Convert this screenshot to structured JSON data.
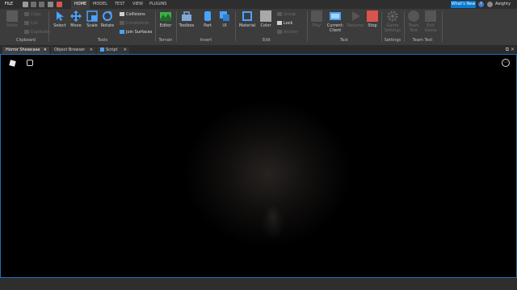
{
  "titlebar": {
    "file_label": "FILE",
    "tabs": [
      "HOME",
      "MODEL",
      "TEST",
      "VIEW",
      "PLUGINS"
    ],
    "active_tab": "HOME",
    "whats_new_label": "What's New",
    "username": "Aeighty"
  },
  "ribbon": {
    "clipboard": {
      "paste": "Paste",
      "copy": "Copy",
      "cut": "Cut",
      "duplicate": "Duplicate",
      "label": "Clipboard"
    },
    "tools": {
      "select": "Select",
      "move": "Move",
      "scale": "Scale",
      "rotate": "Rotate",
      "collisions": "Collisions",
      "constraints": "Constraints",
      "join_surfaces": "Join Surfaces",
      "label": "Tools"
    },
    "terrain": {
      "editor": "Editor",
      "label": "Terrain"
    },
    "insert": {
      "toolbox": "Toolbox",
      "part": "Part",
      "ui": "UI",
      "label": "Insert"
    },
    "edit": {
      "material": "Material",
      "color": "Color",
      "group": "Group",
      "lock": "Lock",
      "anchor": "Anchor",
      "label": "Edit"
    },
    "test": {
      "play": "Play",
      "current_client": "Current:",
      "client": "Client",
      "resume": "Resume",
      "stop": "Stop",
      "label": "Test"
    },
    "settings": {
      "game_settings_1": "Game",
      "game_settings_2": "Settings",
      "label": "Settings"
    },
    "team_test": {
      "team_test_1": "Team",
      "team_test_2": "Test",
      "exit_game_1": "Exit",
      "exit_game_2": "Game",
      "label": "Team Test"
    }
  },
  "doc_tabs": [
    {
      "label": "Horror Showcase",
      "active": true
    },
    {
      "label": "Object Browser",
      "active": false
    },
    {
      "label": "Script",
      "active": false
    }
  ],
  "colors": {
    "accent": "#0b7ad1",
    "viewport_border": "#1f6fb8",
    "stop_red": "#d9534f",
    "terrain_green": "#3fae49"
  }
}
